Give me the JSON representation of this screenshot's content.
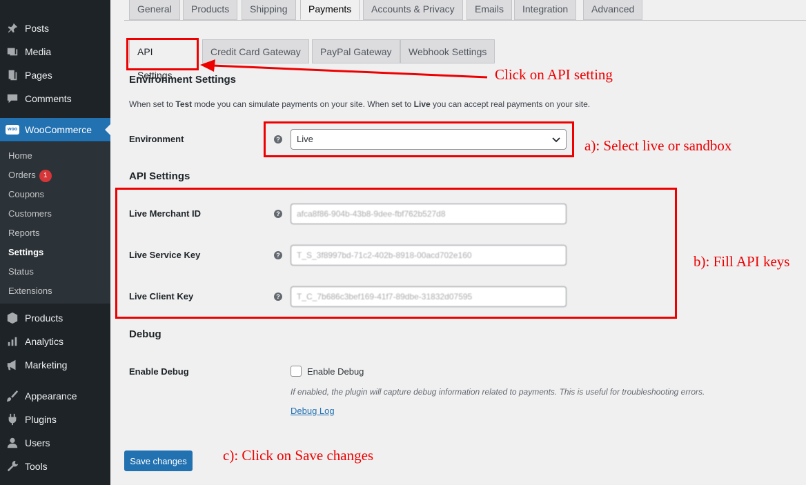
{
  "sidebar": {
    "items_top": [
      {
        "label": "Posts",
        "icon": "pin-icon"
      },
      {
        "label": "Media",
        "icon": "media-icon"
      },
      {
        "label": "Pages",
        "icon": "pages-icon"
      },
      {
        "label": "Comments",
        "icon": "comments-icon"
      }
    ],
    "woocommerce": {
      "label": "WooCommerce",
      "icon": "woo-icon",
      "icon_text": "woo"
    },
    "submenu": [
      {
        "label": "Home"
      },
      {
        "label": "Orders",
        "badge": "1"
      },
      {
        "label": "Coupons"
      },
      {
        "label": "Customers"
      },
      {
        "label": "Reports"
      },
      {
        "label": "Settings",
        "current": true
      },
      {
        "label": "Status"
      },
      {
        "label": "Extensions"
      }
    ],
    "items_bottom": [
      {
        "label": "Products",
        "icon": "products-icon"
      },
      {
        "label": "Analytics",
        "icon": "analytics-icon"
      },
      {
        "label": "Marketing",
        "icon": "megaphone-icon"
      },
      {
        "label": "Appearance",
        "icon": "brush-icon"
      },
      {
        "label": "Plugins",
        "icon": "plugin-icon"
      },
      {
        "label": "Users",
        "icon": "user-icon"
      },
      {
        "label": "Tools",
        "icon": "wrench-icon"
      }
    ]
  },
  "tabs": [
    "General",
    "Products",
    "Shipping",
    "Payments",
    "Accounts & Privacy",
    "Emails",
    "Integration",
    "Advanced"
  ],
  "active_tab": "Payments",
  "subtabs": [
    "API Settings",
    "Credit Card Gateway",
    "PayPal Gateway",
    "Webhook Settings"
  ],
  "active_subtab": "API Settings",
  "environment": {
    "heading": "Environment Settings",
    "desc_1": "When set to ",
    "desc_test": "Test",
    "desc_2": " mode you can simulate payments on your site. When set to ",
    "desc_live": "Live",
    "desc_3": " you can accept real payments on your site.",
    "label": "Environment",
    "selected": "Live"
  },
  "api": {
    "heading": "API Settings",
    "merchant_label": "Live Merchant ID",
    "merchant_value": "afca8f86-904b-43b8-9dee-fbf762b527d8",
    "service_label": "Live Service Key",
    "service_value": "T_S_3f8997bd-71c2-402b-8918-00acd702e160",
    "client_label": "Live Client Key",
    "client_value": "T_C_7b686c3bef169-41f7-89dbe-31832d07595"
  },
  "debug": {
    "heading": "Debug",
    "label": "Enable Debug",
    "checkbox_label": "Enable Debug",
    "description": "If enabled, the plugin will capture debug information related to payments. This is useful for troubleshooting errors.",
    "link": "Debug Log"
  },
  "save_label": "Save changes",
  "annotations": {
    "api": "Click on API setting",
    "env": "a): Select live or sandbox",
    "keys": "b): Fill API keys",
    "save": "c): Click on Save changes"
  },
  "colors": {
    "annotation": "#ee0000",
    "primary": "#2271b1",
    "sidebar": "#1d2327"
  }
}
